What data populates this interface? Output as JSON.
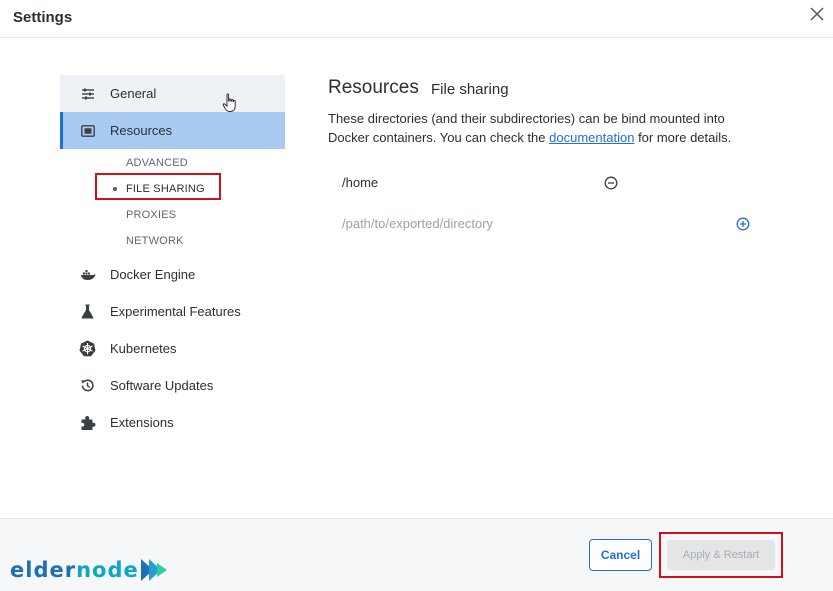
{
  "window": {
    "title": "Settings"
  },
  "sidebar": {
    "items": [
      {
        "label": "General",
        "icon": "sliders-icon"
      },
      {
        "label": "Resources",
        "icon": "resources-icon"
      },
      {
        "label": "Docker Engine",
        "icon": "whale-icon"
      },
      {
        "label": "Experimental Features",
        "icon": "flask-icon"
      },
      {
        "label": "Kubernetes",
        "icon": "kubernetes-icon"
      },
      {
        "label": "Software Updates",
        "icon": "history-icon"
      },
      {
        "label": "Extensions",
        "icon": "puzzle-icon"
      }
    ],
    "resources_sub": [
      {
        "label": "ADVANCED"
      },
      {
        "label": "FILE SHARING"
      },
      {
        "label": "PROXIES"
      },
      {
        "label": "NETWORK"
      }
    ]
  },
  "content": {
    "title": "Resources",
    "subtitle": "File sharing",
    "desc_part1": "These directories (and their subdirectories) can be bind mounted into Docker containers. You can check the",
    "desc_link": "documentation",
    "desc_part2": "for more details.",
    "directories": [
      "/home"
    ],
    "new_dir_placeholder": "/path/to/exported/directory"
  },
  "footer": {
    "cancel_label": "Cancel",
    "apply_label": "Apply & Restart"
  },
  "brand": {
    "logo_text_1": "elder",
    "logo_text_2": "node"
  },
  "colors": {
    "accent": "#1e6fd9",
    "active_bg": "#a9cbf2",
    "highlight": "#d0111b"
  }
}
